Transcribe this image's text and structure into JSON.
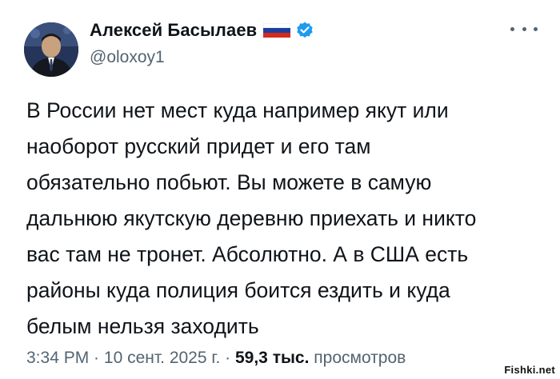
{
  "author": {
    "display_name": "Алексей Басылаев",
    "handle": "@oloxoy1",
    "flag_icon": "russian-flag-icon",
    "verified_icon": "verified-badge-icon",
    "verified_color": "#1d9bf0"
  },
  "post": {
    "lines": [
      "В России нет мест куда например якут или",
      "наоборот русский придет и его там",
      "обязательно побьют. Вы можете в самую",
      "дальнюю якутскую деревню приехать и никто",
      "вас там не тронет. Абсолютно. А в США есть",
      "районы куда полиция боится ездить и куда",
      "белым нельзя заходить"
    ]
  },
  "meta": {
    "time": "3:34 PM",
    "separator1": " · ",
    "date": "10 сент. 2025 г.",
    "separator2": " · ",
    "views_count": "59,3 тыс.",
    "views_label": " просмотров"
  },
  "watermark": "Fishki.net",
  "more_icon": "more-options-icon"
}
